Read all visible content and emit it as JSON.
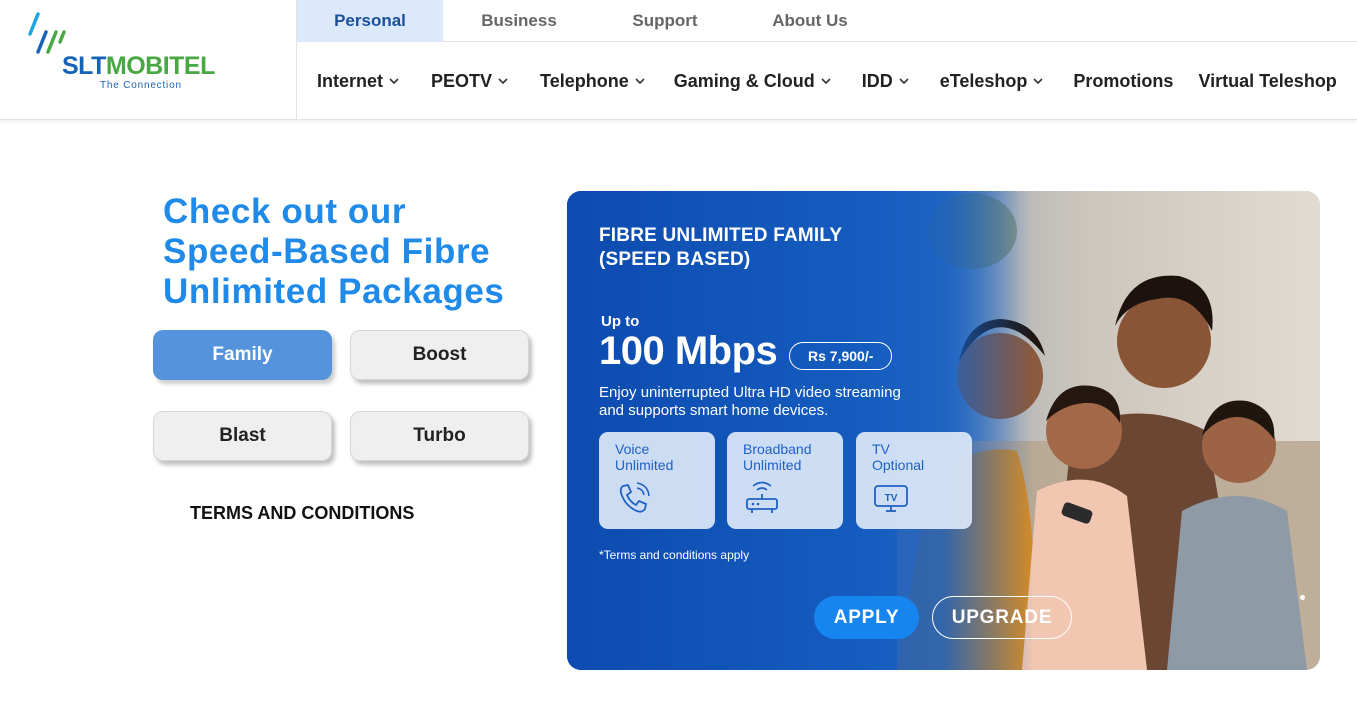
{
  "brand": {
    "name_part1": "SLT",
    "name_part2": "MOBITEL",
    "tagline": "The Connection",
    "blue": "#1763b8",
    "green": "#49a843"
  },
  "top_tabs": [
    "Personal",
    "Business",
    "Support",
    "About Us"
  ],
  "active_top_tab": "Personal",
  "main_nav": [
    {
      "label": "Internet",
      "dropdown": true
    },
    {
      "label": "PEOTV",
      "dropdown": true
    },
    {
      "label": "Telephone",
      "dropdown": true
    },
    {
      "label": "Gaming & Cloud",
      "dropdown": true
    },
    {
      "label": "IDD",
      "dropdown": true
    },
    {
      "label": "eTeleshop",
      "dropdown": true
    },
    {
      "label": "Promotions",
      "dropdown": false
    },
    {
      "label": "Virtual Teleshop",
      "dropdown": false
    }
  ],
  "headline": {
    "line1": "Check out our",
    "line2": "Speed-Based Fibre",
    "line3": "Unlimited Packages",
    "color": "#1f8ae8"
  },
  "packages": {
    "buttons": [
      "Family",
      "Boost",
      "Blast",
      "Turbo"
    ],
    "selected": "Family",
    "active_color": "#5594dc"
  },
  "terms_link": "TERMS AND CONDITIONS",
  "banner": {
    "title_line1": "FIBRE UNLIMITED FAMILY",
    "title_line2": "(SPEED BASED)",
    "up_to": "Up to",
    "speed": "100 Mbps",
    "price": "Rs 7,900/-",
    "desc_line1": "Enjoy uninterrupted Ultra HD video streaming",
    "desc_line2": "and supports smart home devices.",
    "features": [
      {
        "line1": "Voice",
        "line2": "Unlimited",
        "icon": "phone-icon"
      },
      {
        "line1": "Broadband",
        "line2": "Unlimited",
        "icon": "router-icon"
      },
      {
        "line1": "TV",
        "line2": "Optional",
        "icon": "tv-icon"
      }
    ],
    "terms_note": "*Terms and conditions apply",
    "apply_label": "APPLY",
    "upgrade_label": "UPGRADE",
    "apply_color": "#1685f0"
  }
}
